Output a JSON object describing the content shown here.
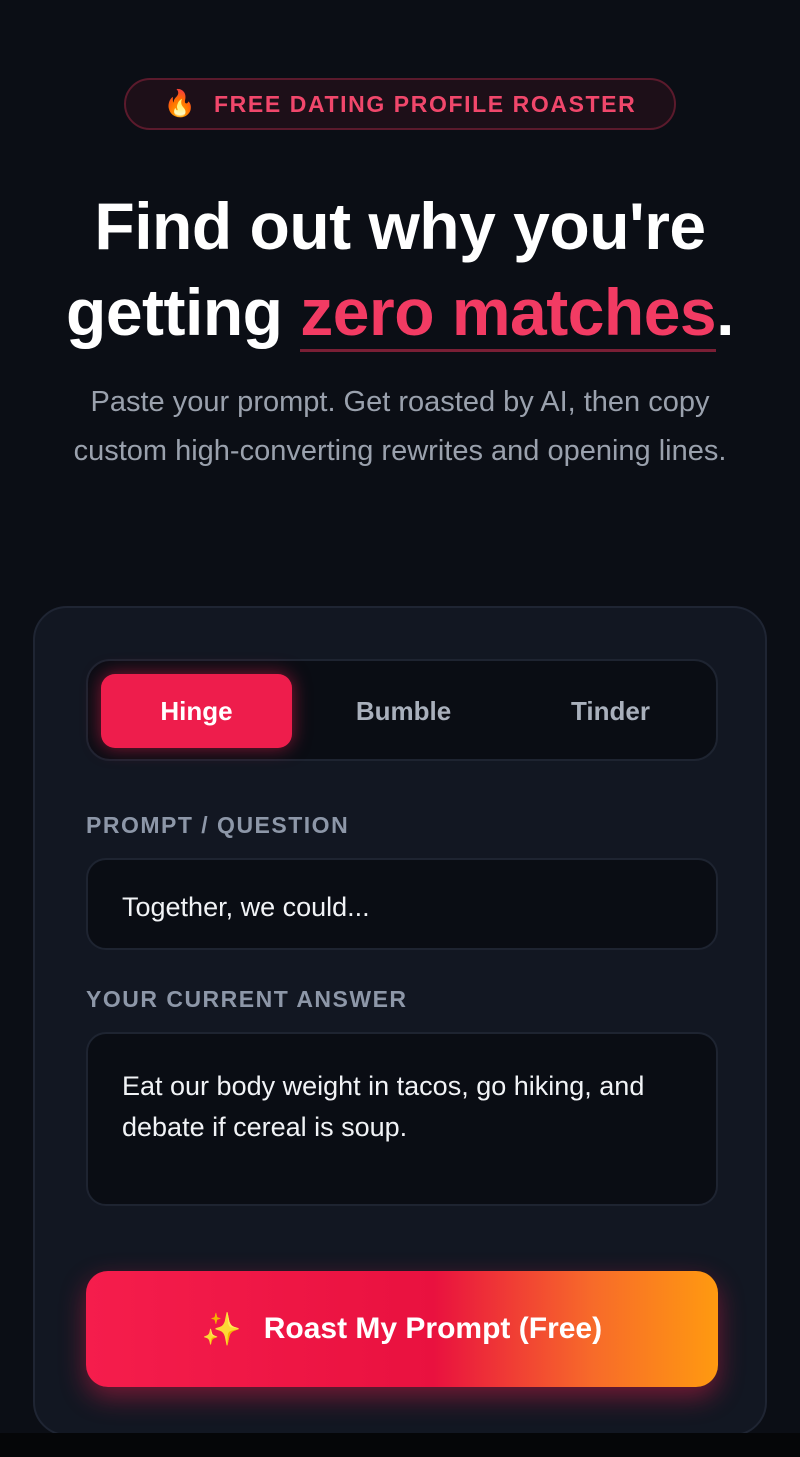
{
  "badge": {
    "icon": "fire-icon",
    "icon_glyph": "🔥",
    "label": "FREE DATING PROFILE ROASTER"
  },
  "headline": {
    "line1": "Find out why you're",
    "line2_prefix": "getting ",
    "accent": "zero matches",
    "suffix": "."
  },
  "subtitle": "Paste your prompt. Get roasted by AI, then copy custom high-converting rewrites and opening lines.",
  "tabs": [
    {
      "label": "Hinge",
      "active": true
    },
    {
      "label": "Bumble",
      "active": false
    },
    {
      "label": "Tinder",
      "active": false
    }
  ],
  "prompt_field": {
    "label": "PROMPT / QUESTION",
    "value": "Together, we could..."
  },
  "answer_field": {
    "label": "YOUR CURRENT ANSWER",
    "value": "Eat our body weight in tacos, go hiking, and debate if cereal is soup."
  },
  "cta": {
    "icon": "sparkles-icon",
    "icon_glyph": "✨",
    "label": "Roast My Prompt (Free)"
  },
  "colors": {
    "accent": "#f23b63",
    "background": "#0b0e15",
    "card": "#121722",
    "cta_end": "#ff9a10"
  }
}
